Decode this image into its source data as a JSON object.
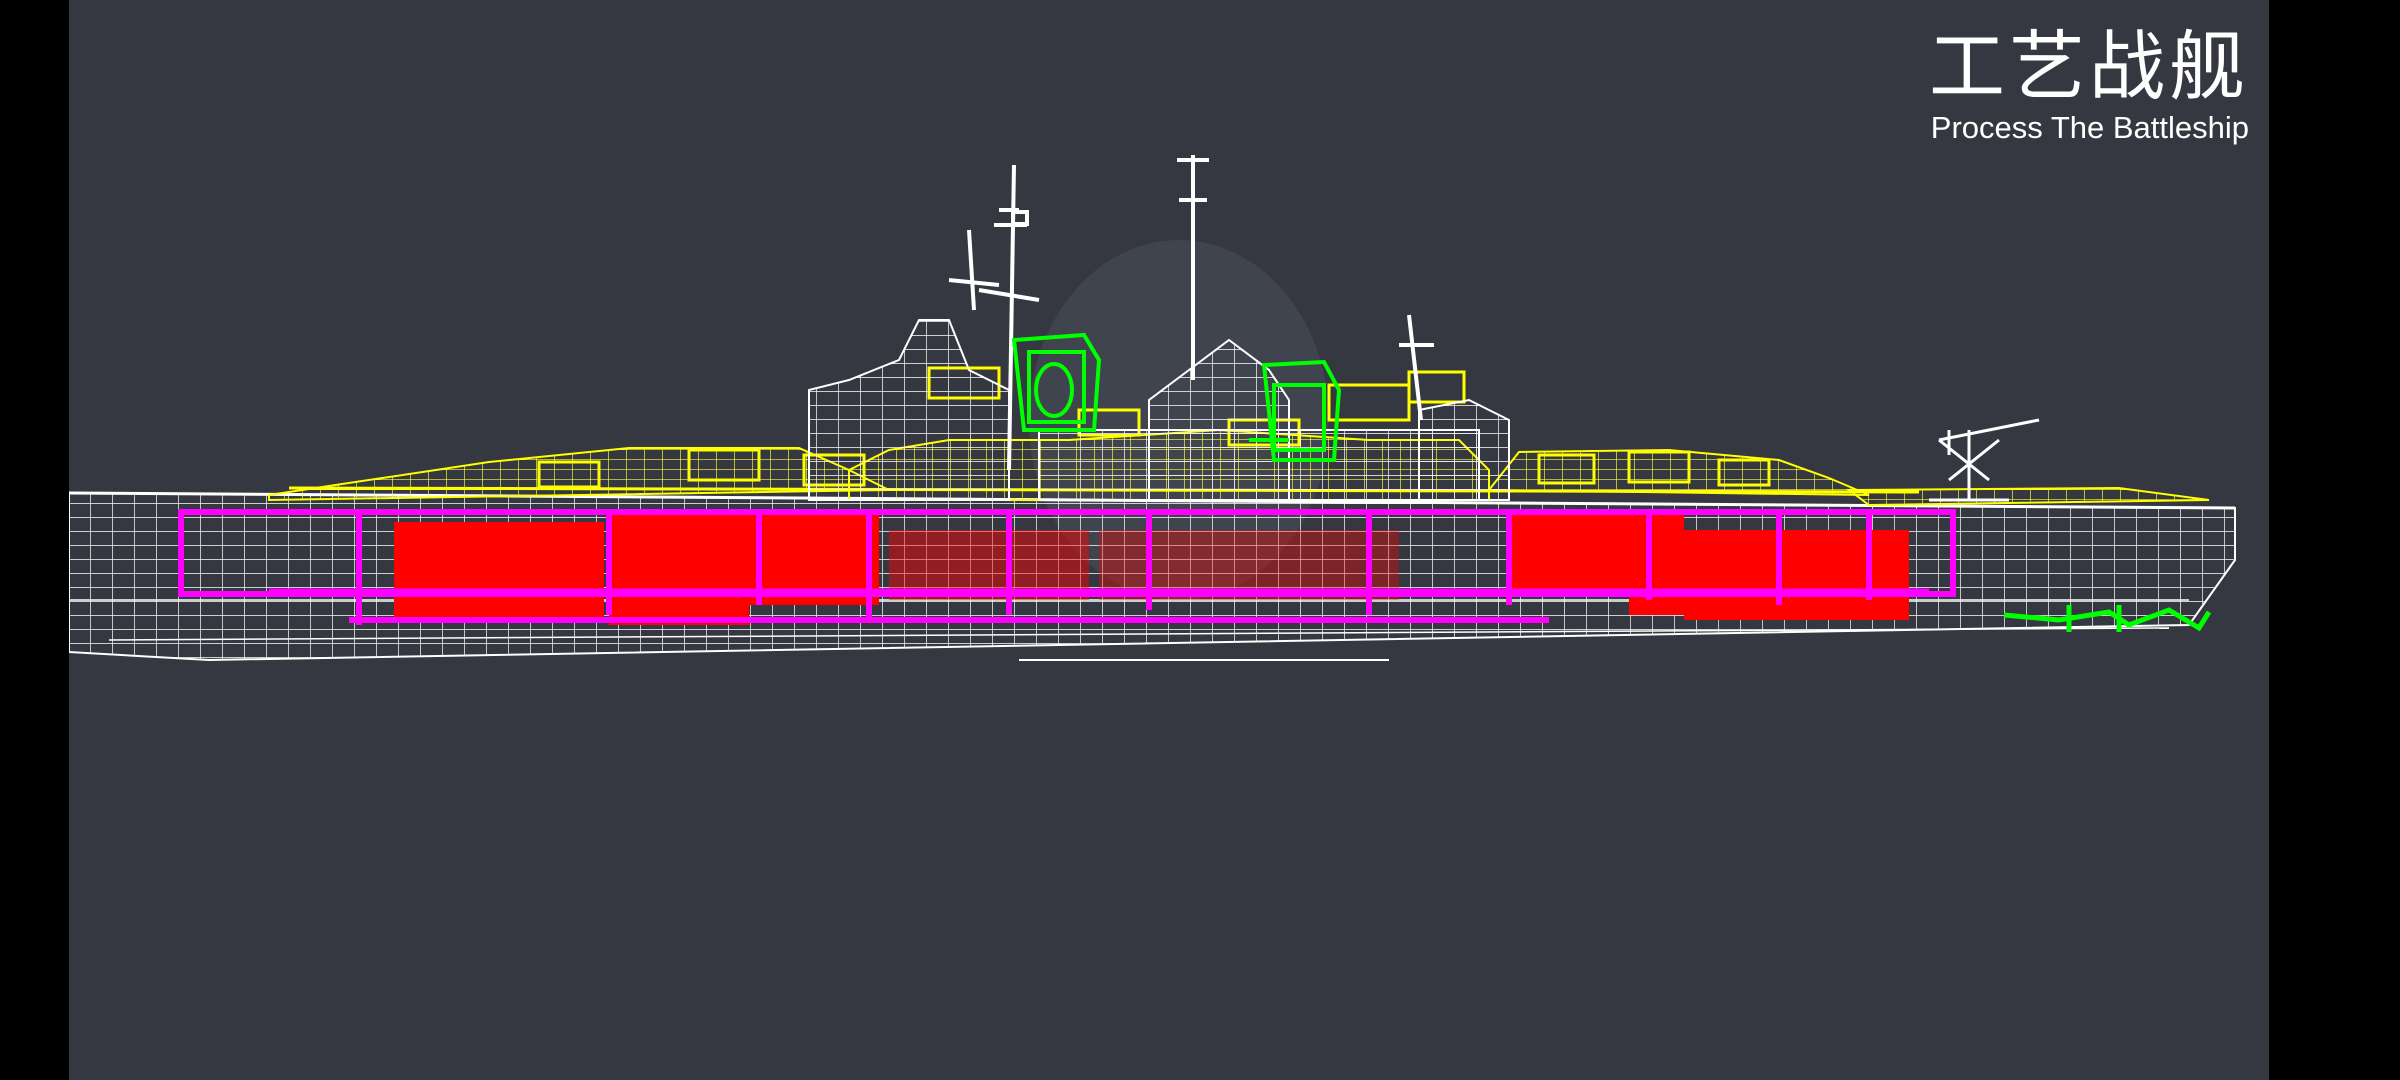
{
  "title": {
    "zh": "工艺战舰",
    "en": "Process The Battleship"
  },
  "colors": {
    "background": "#353841",
    "letterbox": "#000000",
    "hull_wireframe": "#ffffff",
    "superstructure_highlight": "#ffff00",
    "turret_highlight": "#00ff00",
    "armor_belt_frame": "#ff00ff",
    "armor_blocks": "#ff0000",
    "stern_detail": "#00ff00"
  },
  "model": {
    "name": "battleship-wireframe-side-view"
  }
}
